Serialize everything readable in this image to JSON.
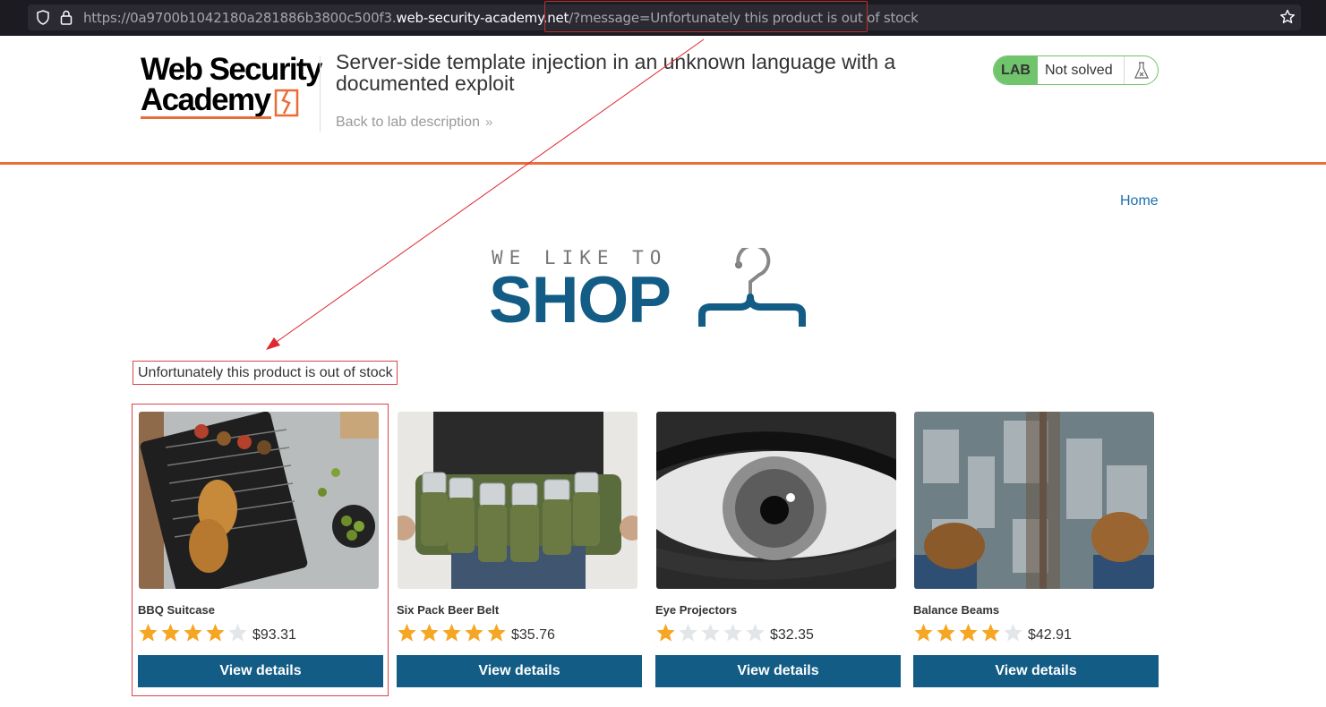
{
  "browser": {
    "url_prefix": "https://0a9700b1042180a281886b3800c500f3.",
    "url_domain": "web-security-academy.net",
    "url_path": "/",
    "url_query": "?message=Unfortunately this product is out of stock"
  },
  "header": {
    "logo_line1": "Web Security",
    "logo_line2": "Academy",
    "lab_title": "Server-side template injection in an unknown language with a documented exploit",
    "back_link": "Back to lab description",
    "status_tag": "LAB",
    "status_text": "Not solved"
  },
  "nav": {
    "home": "Home"
  },
  "shop_logo": {
    "small": "WE LIKE TO",
    "big": "SHOP"
  },
  "message": "Unfortunately this product is out of stock",
  "products": [
    {
      "name": "BBQ Suitcase",
      "price": "$93.31",
      "rating": 4,
      "button": "View details",
      "image": "grilled-food-photo"
    },
    {
      "name": "Six Pack Beer Belt",
      "price": "$35.76",
      "rating": 5,
      "button": "View details",
      "image": "beer-belt-photo"
    },
    {
      "name": "Eye Projectors",
      "price": "$32.35",
      "rating": 1,
      "button": "View details",
      "image": "eye-closeup-photo"
    },
    {
      "name": "Balance Beams",
      "price": "$42.91",
      "rating": 4,
      "button": "View details",
      "image": "city-beam-photo"
    }
  ],
  "colors": {
    "accent": "#ea6c37",
    "brand": "#125c85",
    "lab_green": "#70c56c",
    "star": "#f5a623",
    "highlight": "#d9444a"
  }
}
